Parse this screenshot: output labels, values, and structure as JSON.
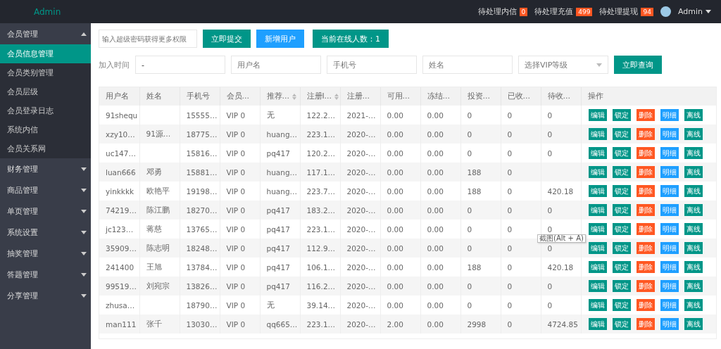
{
  "header": {
    "logo": "Admin",
    "notices": [
      {
        "label": "待处理内信",
        "count": "0"
      },
      {
        "label": "待处理充值",
        "count": "499"
      },
      {
        "label": "待处理提现",
        "count": "94"
      }
    ],
    "user": "Admin"
  },
  "sidebar": {
    "groups": [
      {
        "label": "会员管理",
        "expanded": true,
        "children": [
          {
            "label": "会员信息管理",
            "selected": true
          },
          {
            "label": "会员类别管理",
            "selected": false
          },
          {
            "label": "会员层级",
            "selected": false
          },
          {
            "label": "会员登录日志",
            "selected": false
          },
          {
            "label": "系统内信",
            "selected": false
          },
          {
            "label": "会员关系网",
            "selected": false
          }
        ]
      },
      {
        "label": "财务管理",
        "expanded": false
      },
      {
        "label": "商品管理",
        "expanded": false
      },
      {
        "label": "单页管理",
        "expanded": false
      },
      {
        "label": "系统设置",
        "expanded": false
      },
      {
        "label": "抽奖管理",
        "expanded": false
      },
      {
        "label": "答题管理",
        "expanded": false
      },
      {
        "label": "分享管理",
        "expanded": false
      }
    ]
  },
  "toolbar": {
    "password": {
      "placeholder": "输入超级密码获得更多权限"
    },
    "submit": "立即提交",
    "add_user": "新增用户",
    "online": "当前在线人数：1"
  },
  "filters": {
    "date_label": "加入时间",
    "date": {
      "value": "-"
    },
    "username": {
      "placeholder": "用户名"
    },
    "phone": {
      "placeholder": "手机号"
    },
    "name": {
      "placeholder": "姓名"
    },
    "vip": {
      "placeholder": "选择VIP等级"
    },
    "query": "立即查询"
  },
  "table": {
    "columns": [
      {
        "label": "用户名",
        "sortable": false
      },
      {
        "label": "姓名",
        "sortable": false
      },
      {
        "label": "手机号",
        "sortable": false
      },
      {
        "label": "会员…",
        "sortable": false
      },
      {
        "label": "推荐…",
        "sortable": true
      },
      {
        "label": "注册I…",
        "sortable": true
      },
      {
        "label": "注册…",
        "sortable": false
      },
      {
        "label": "可用…",
        "sortable": false
      },
      {
        "label": "冻结…",
        "sortable": false
      },
      {
        "label": "投资…",
        "sortable": false
      },
      {
        "label": "已收…",
        "sortable": false
      },
      {
        "label": "待收…",
        "sortable": false
      },
      {
        "label": "操作",
        "sortable": false
      }
    ],
    "rows": [
      {
        "cells": [
          "91shequ",
          "",
          "15555…",
          "VIP 0",
          "无",
          "122.2…",
          "2021-…",
          "0.00",
          "0.00",
          "0",
          "0",
          "0"
        ],
        "actions": [
          {
            "label": "编辑",
            "color": "#009688"
          },
          {
            "label": "锁定",
            "color": "#009688"
          },
          {
            "label": "删除",
            "color": "#ff5722"
          },
          {
            "label": "明细",
            "color": "#1e9fff"
          },
          {
            "label": "离线",
            "color": "#009688"
          }
        ]
      },
      {
        "cells": [
          "xzy10…",
          "91源…",
          "18775…",
          "VIP 0",
          "huang…",
          "223.1…",
          "2020-…",
          "0.00",
          "0.00",
          "0",
          "0",
          "0"
        ],
        "actions": [
          {
            "label": "编辑",
            "color": "#009688"
          },
          {
            "label": "锁定",
            "color": "#009688"
          },
          {
            "label": "删除",
            "color": "#ff5722"
          },
          {
            "label": "明细",
            "color": "#1e9fff"
          },
          {
            "label": "离线",
            "color": "#009688"
          }
        ]
      },
      {
        "cells": [
          "uc147…",
          "",
          "15816…",
          "VIP 0",
          "pq417",
          "120.2…",
          "2020-…",
          "0.00",
          "0.00",
          "0",
          "0",
          "0"
        ],
        "actions": [
          {
            "label": "编辑",
            "color": "#009688"
          },
          {
            "label": "锁定",
            "color": "#009688"
          },
          {
            "label": "删除",
            "color": "#ff5722"
          },
          {
            "label": "明细",
            "color": "#1e9fff"
          },
          {
            "label": "离线",
            "color": "#009688"
          }
        ]
      },
      {
        "cells": [
          "luan666",
          "邓勇",
          "15881…",
          "VIP 0",
          "huang…",
          "117.1…",
          "2020-…",
          "0.00",
          "0.00",
          "188",
          "0",
          ""
        ],
        "actions": [
          {
            "label": "编辑",
            "color": "#009688"
          },
          {
            "label": "锁定",
            "color": "#009688"
          },
          {
            "label": "删除",
            "color": "#ff5722"
          },
          {
            "label": "明细",
            "color": "#1e9fff"
          },
          {
            "label": "离线",
            "color": "#009688"
          }
        ]
      },
      {
        "cells": [
          "yinkkkk",
          "欧艳平",
          "19198…",
          "VIP 0",
          "huang…",
          "223.7…",
          "2020-…",
          "0.00",
          "0.00",
          "188",
          "0",
          "420.18"
        ],
        "actions": [
          {
            "label": "编辑",
            "color": "#009688"
          },
          {
            "label": "锁定",
            "color": "#009688"
          },
          {
            "label": "删除",
            "color": "#ff5722"
          },
          {
            "label": "明细",
            "color": "#1e9fff"
          },
          {
            "label": "离线",
            "color": "#009688"
          }
        ]
      },
      {
        "cells": [
          "74219…",
          "陈江鹏",
          "18270…",
          "VIP 0",
          "pq417",
          "183.2…",
          "2020-…",
          "0.00",
          "0.00",
          "0",
          "0",
          "0"
        ],
        "actions": [
          {
            "label": "编辑",
            "color": "#009688"
          },
          {
            "label": "锁定",
            "color": "#009688"
          },
          {
            "label": "删除",
            "color": "#ff5722"
          },
          {
            "label": "明细",
            "color": "#1e9fff"
          },
          {
            "label": "离线",
            "color": "#009688"
          }
        ]
      },
      {
        "cells": [
          "jc123…",
          "蒋慈",
          "13765…",
          "VIP 0",
          "pq417",
          "223.1…",
          "2020-…",
          "0.00",
          "0.00",
          "0",
          "0",
          "0"
        ],
        "actions": [
          {
            "label": "编辑",
            "color": "#009688"
          },
          {
            "label": "锁定",
            "color": "#009688"
          },
          {
            "label": "删除",
            "color": "#ff5722"
          },
          {
            "label": "明细",
            "color": "#1e9fff"
          },
          {
            "label": "离线",
            "color": "#009688"
          }
        ]
      },
      {
        "cells": [
          "35909…",
          "陈志明",
          "18248…",
          "VIP 0",
          "pq417",
          "112.9…",
          "2020-…",
          "0.00",
          "0.00",
          "0",
          "0",
          "0"
        ],
        "actions": [
          {
            "label": "编辑",
            "color": "#009688"
          },
          {
            "label": "锁定",
            "color": "#009688"
          },
          {
            "label": "删除",
            "color": "#ff5722"
          },
          {
            "label": "明细",
            "color": "#1e9fff"
          },
          {
            "label": "离线",
            "color": "#009688"
          }
        ]
      },
      {
        "cells": [
          "241400",
          "王旭",
          "13784…",
          "VIP 0",
          "pq417",
          "106.1…",
          "2020-…",
          "0.00",
          "0.00",
          "188",
          "0",
          "420.18"
        ],
        "actions": [
          {
            "label": "编辑",
            "color": "#009688"
          },
          {
            "label": "锁定",
            "color": "#009688"
          },
          {
            "label": "删除",
            "color": "#ff5722"
          },
          {
            "label": "明细",
            "color": "#1e9fff"
          },
          {
            "label": "离线",
            "color": "#009688"
          }
        ]
      },
      {
        "cells": [
          "99519…",
          "刘宛宗",
          "13826…",
          "VIP 0",
          "pq417",
          "116.2…",
          "2020-…",
          "0.00",
          "0.00",
          "0",
          "0",
          "0"
        ],
        "actions": [
          {
            "label": "编辑",
            "color": "#009688"
          },
          {
            "label": "锁定",
            "color": "#009688"
          },
          {
            "label": "删除",
            "color": "#ff5722"
          },
          {
            "label": "明细",
            "color": "#1e9fff"
          },
          {
            "label": "离线",
            "color": "#009688"
          }
        ]
      },
      {
        "cells": [
          "zhusa…",
          "",
          "18790…",
          "VIP 0",
          "无",
          "39.14…",
          "2020-…",
          "0.00",
          "0.00",
          "0",
          "0",
          "0"
        ],
        "actions": [
          {
            "label": "编辑",
            "color": "#009688"
          },
          {
            "label": "锁定",
            "color": "#009688"
          },
          {
            "label": "删除",
            "color": "#ff5722"
          },
          {
            "label": "明细",
            "color": "#1e9fff"
          },
          {
            "label": "离线",
            "color": "#009688"
          }
        ]
      },
      {
        "cells": [
          "man111",
          "张千",
          "13030…",
          "VIP 0",
          "qq665…",
          "223.1…",
          "2020-…",
          "2.00",
          "0.00",
          "2998",
          "0",
          "4724.85"
        ],
        "actions": [
          {
            "label": "编辑",
            "color": "#009688"
          },
          {
            "label": "锁定",
            "color": "#009688"
          },
          {
            "label": "删除",
            "color": "#ff5722"
          },
          {
            "label": "明细",
            "color": "#1e9fff"
          },
          {
            "label": "离线",
            "color": "#009688"
          }
        ]
      }
    ]
  },
  "tooltip": "截图(Alt + A)"
}
